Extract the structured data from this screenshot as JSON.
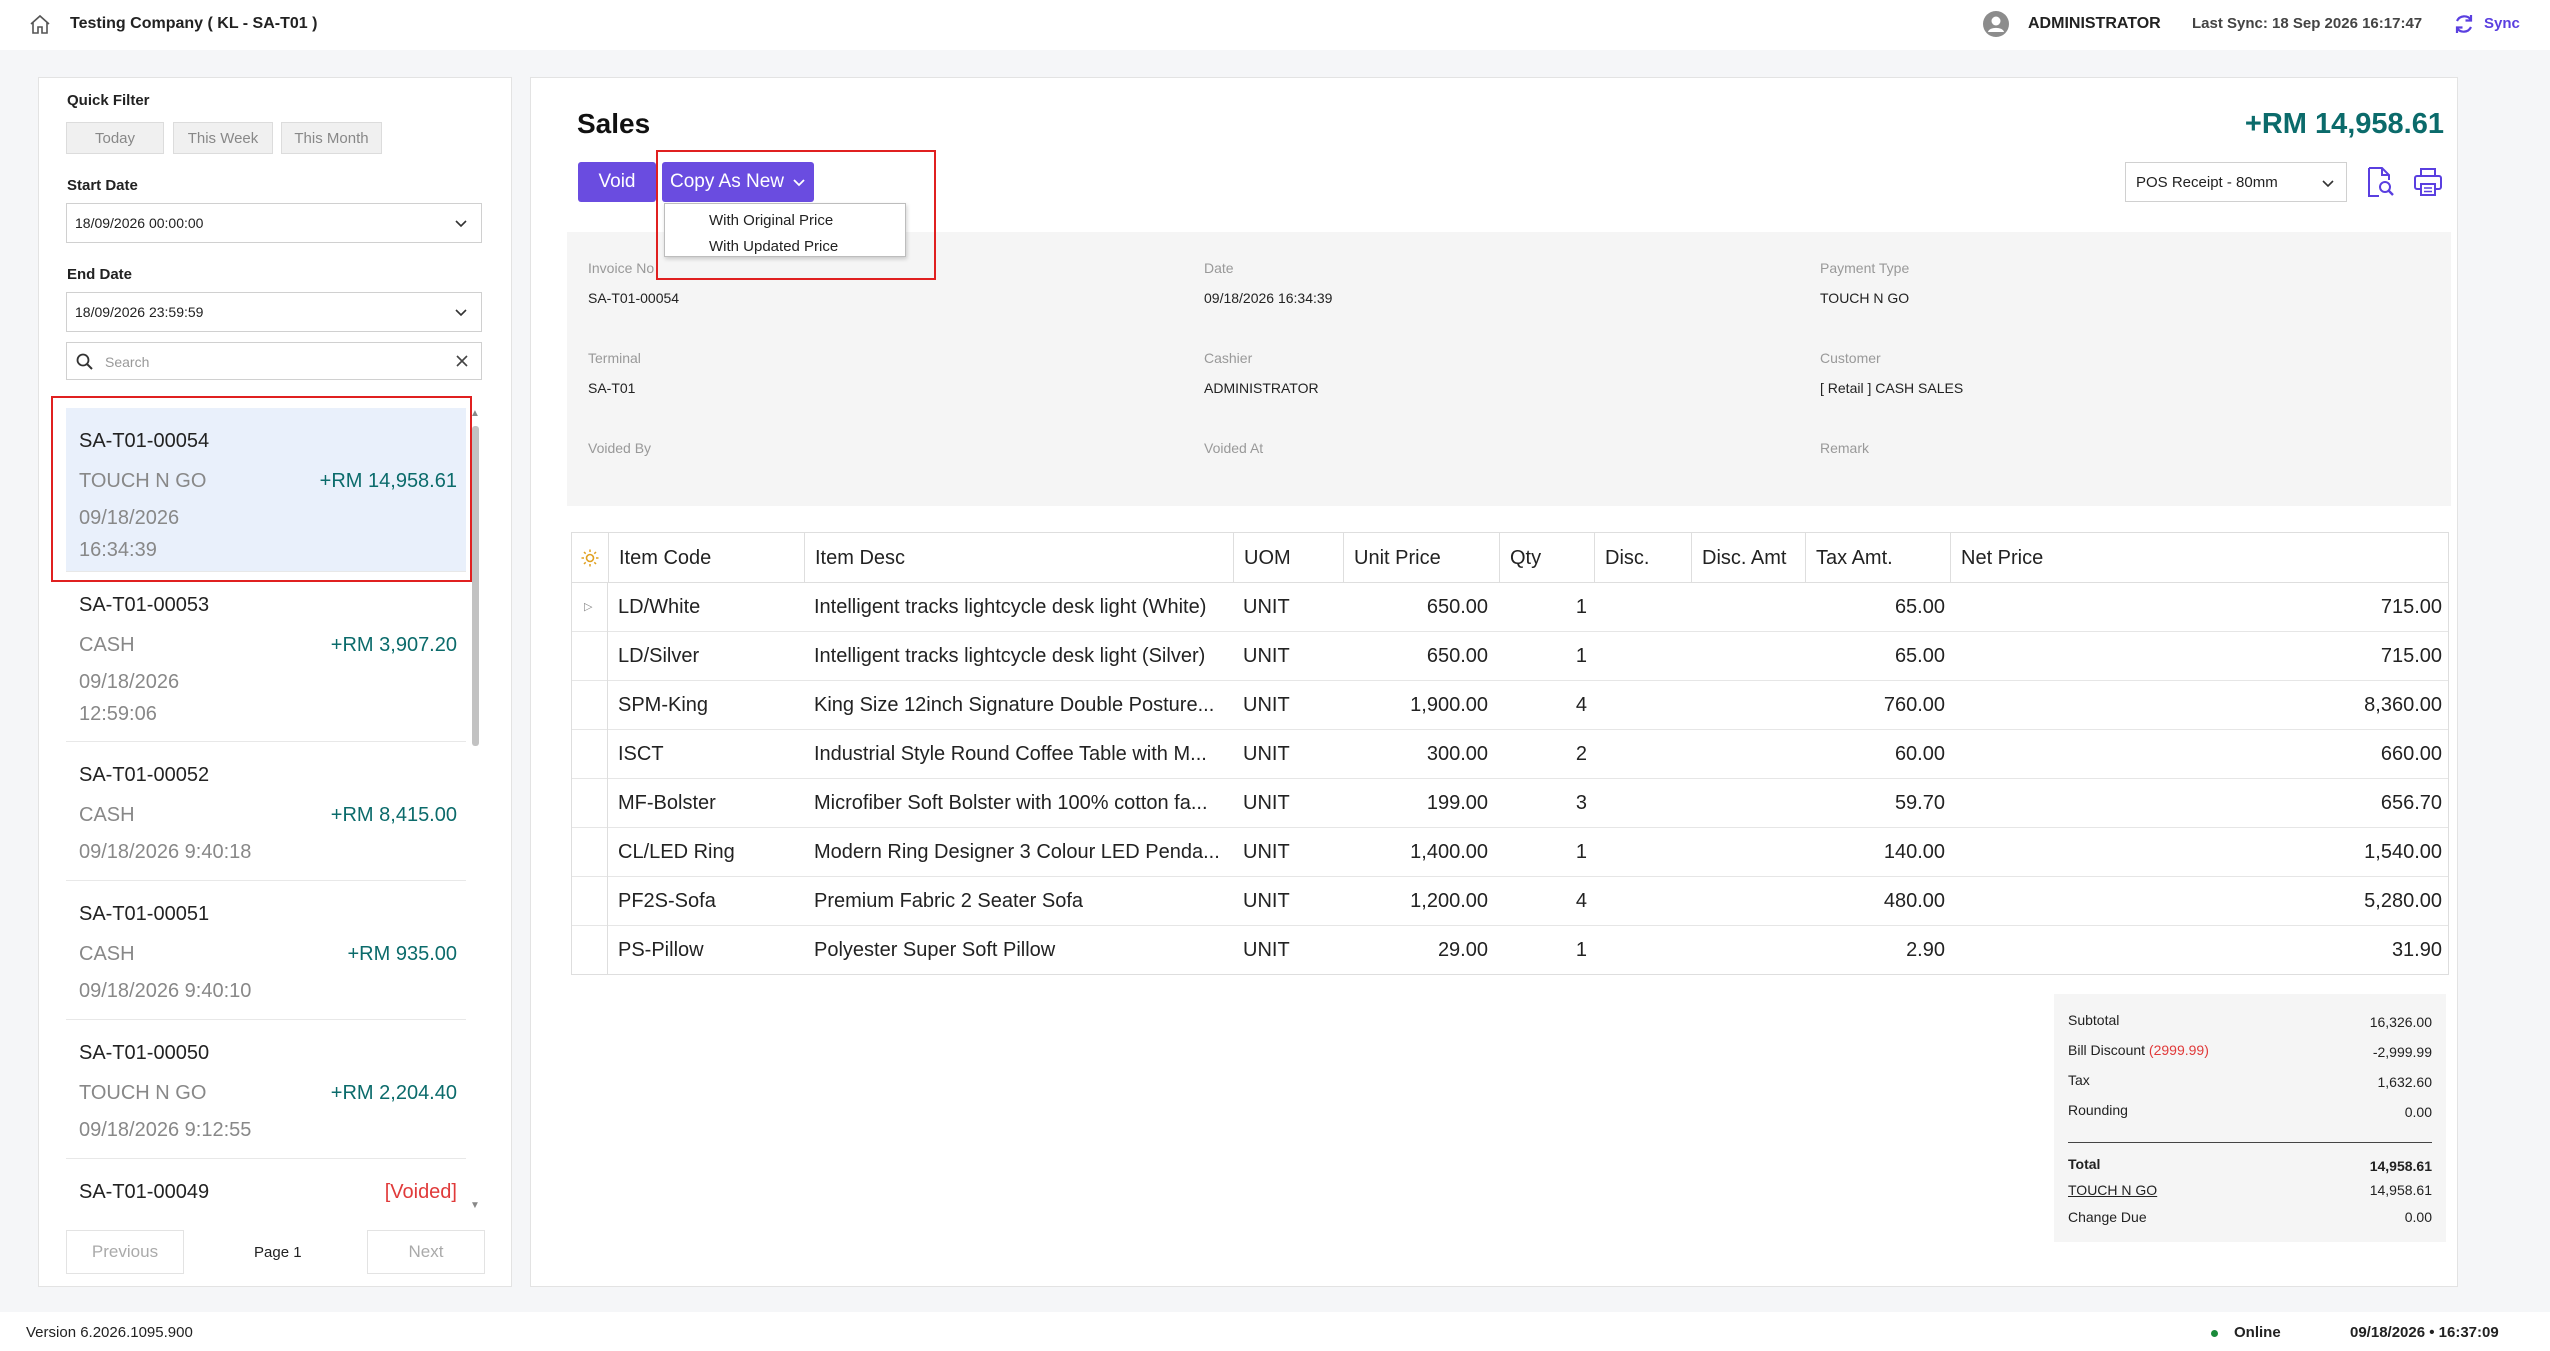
{
  "header": {
    "company": "Testing Company ( KL - SA-T01 )",
    "user": "ADMINISTRATOR",
    "last_sync": "Last Sync: 18 Sep 2026 16:17:47",
    "sync_label": "Sync"
  },
  "filter": {
    "quick_filter_label": "Quick Filter",
    "quick_buttons": [
      "Today",
      "This Week",
      "This Month"
    ],
    "start_date_label": "Start Date",
    "start_date_value": "18/09/2026 00:00:00",
    "end_date_label": "End Date",
    "end_date_value": "18/09/2026 23:59:59",
    "search_placeholder": "Search"
  },
  "list": [
    {
      "code": "SA-T01-00054",
      "payment": "TOUCH N GO",
      "amount": "+RM 14,958.61",
      "date_line1": "09/18/2026",
      "date_line2": "16:34:39"
    },
    {
      "code": "SA-T01-00053",
      "payment": "CASH",
      "amount": "+RM 3,907.20",
      "date_line1": "09/18/2026",
      "date_line2": "12:59:06"
    },
    {
      "code": "SA-T01-00052",
      "payment": "CASH",
      "amount": "+RM 8,415.00",
      "date_line1": "09/18/2026 9:40:18",
      "date_line2": ""
    },
    {
      "code": "SA-T01-00051",
      "payment": "CASH",
      "amount": "+RM 935.00",
      "date_line1": "09/18/2026 9:40:10",
      "date_line2": ""
    },
    {
      "code": "SA-T01-00050",
      "payment": "TOUCH N GO",
      "amount": "+RM 2,204.40",
      "date_line1": "09/18/2026 9:12:55",
      "date_line2": ""
    },
    {
      "code": "SA-T01-00049",
      "payment": "",
      "amount": "[Voided]",
      "date_line1": "",
      "date_line2": ""
    }
  ],
  "pager": {
    "previous": "Previous",
    "page": "Page 1",
    "next": "Next"
  },
  "sales": {
    "title": "Sales",
    "total": "+RM 14,958.61",
    "void_label": "Void",
    "copy_label": "Copy As New",
    "copy_options": [
      "With Original Price",
      "With Updated Price"
    ],
    "receipt_format": "POS Receipt - 80mm"
  },
  "info": {
    "invoice_no_label": "Invoice No",
    "invoice_no": "SA-T01-00054",
    "date_label": "Date",
    "date": "09/18/2026 16:34:39",
    "payment_type_label": "Payment Type",
    "payment_type": "TOUCH N GO",
    "terminal_label": "Terminal",
    "terminal": "SA-T01",
    "cashier_label": "Cashier",
    "cashier": "ADMINISTRATOR",
    "customer_label": "Customer",
    "customer": "[ Retail ] CASH SALES",
    "voided_by_label": "Voided By",
    "voided_at_label": "Voided At",
    "remark_label": "Remark"
  },
  "table": {
    "headers": [
      "Item Code",
      "Item Desc",
      "UOM",
      "Unit Price",
      "Qty",
      "Disc.",
      "Disc. Amt",
      "Tax Amt.",
      "Net Price"
    ],
    "rows": [
      [
        "LD/White",
        "Intelligent tracks lightcycle desk light (White)",
        "UNIT",
        "650.00",
        "1",
        "",
        "",
        "65.00",
        "715.00"
      ],
      [
        "LD/Silver",
        "Intelligent tracks lightcycle desk light (Silver)",
        "UNIT",
        "650.00",
        "1",
        "",
        "",
        "65.00",
        "715.00"
      ],
      [
        "SPM-King",
        "King Size 12inch Signature Double Posture...",
        "UNIT",
        "1,900.00",
        "4",
        "",
        "",
        "760.00",
        "8,360.00"
      ],
      [
        "ISCT",
        "Industrial Style Round Coffee Table with M...",
        "UNIT",
        "300.00",
        "2",
        "",
        "",
        "60.00",
        "660.00"
      ],
      [
        "MF-Bolster",
        "Microfiber Soft Bolster with 100% cotton fa...",
        "UNIT",
        "199.00",
        "3",
        "",
        "",
        "59.70",
        "656.70"
      ],
      [
        "CL/LED Ring",
        "Modern Ring Designer 3 Colour LED Penda...",
        "UNIT",
        "1,400.00",
        "1",
        "",
        "",
        "140.00",
        "1,540.00"
      ],
      [
        "PF2S-Sofa",
        "Premium Fabric 2 Seater Sofa",
        "UNIT",
        "1,200.00",
        "4",
        "",
        "",
        "480.00",
        "5,280.00"
      ],
      [
        "PS-Pillow",
        "Polyester Super Soft Pillow",
        "UNIT",
        "29.00",
        "1",
        "",
        "",
        "2.90",
        "31.90"
      ]
    ]
  },
  "totals": {
    "subtotal_label": "Subtotal",
    "subtotal": "16,326.00",
    "bill_discount_label": "Bill Discount",
    "bill_discount_note": "(2999.99)",
    "bill_discount": "-2,999.99",
    "tax_label": "Tax",
    "tax": "1,632.60",
    "rounding_label": "Rounding",
    "rounding": "0.00",
    "total_label": "Total",
    "total": "14,958.61",
    "payment_label": "TOUCH N GO",
    "payment": "14,958.61",
    "change_label": "Change Due",
    "change": "0.00"
  },
  "footer": {
    "version": "Version 6.2026.1095.900",
    "status": "Online",
    "datetime": "09/18/2026 • 16:37:09"
  },
  "colors": {
    "accent": "#6a4ce0",
    "amount": "#0b6b6b",
    "voided": "#e03a3a",
    "highlight": "#e02020"
  }
}
